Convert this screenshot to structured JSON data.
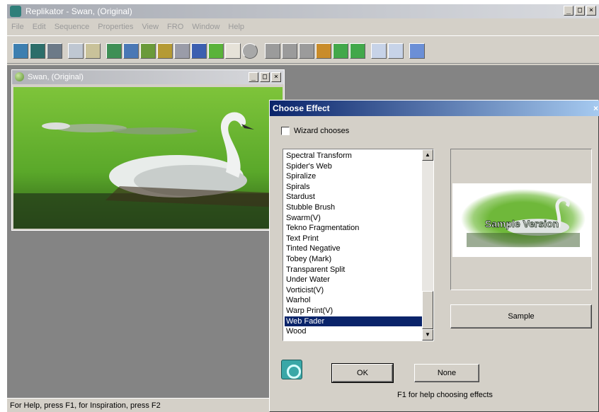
{
  "app": {
    "title": "Replikator - Swan, (Original)",
    "menu": [
      "File",
      "Edit",
      "Sequence",
      "Properties",
      "View",
      "FRO",
      "Window",
      "Help"
    ],
    "status": "For Help, press F1, for Inspiration, press F2"
  },
  "child_window": {
    "title": "Swan, (Original)"
  },
  "window_buttons": {
    "minimize": "_",
    "maximize": "□",
    "close": "×"
  },
  "dialog": {
    "title": "Choose Effect",
    "close": "×",
    "wizard_label": "Wizard chooses",
    "effects": [
      "Spectral Transform",
      "Spider's Web",
      "Spiralize",
      "Spirals",
      "Stardust",
      "Stubble Brush",
      "Swarm(V)",
      "Tekno Fragmentation",
      "Text Print",
      "Tinted Negative",
      "Tobey (Mark)",
      "Transparent Split",
      "Under Water",
      "Vorticist(V)",
      "Warhol",
      "Warp Print(V)",
      "Web Fader",
      "Wood"
    ],
    "selected_effect": "Web Fader",
    "preview_text": "Sample Version",
    "sample_label": "Sample",
    "ok_label": "OK",
    "none_label": "None",
    "help_text": "F1 for help choosing effects"
  },
  "colors": {
    "accent": "#0a246a",
    "window_bg": "#d4d0c8",
    "workspace_bg": "#848484"
  }
}
